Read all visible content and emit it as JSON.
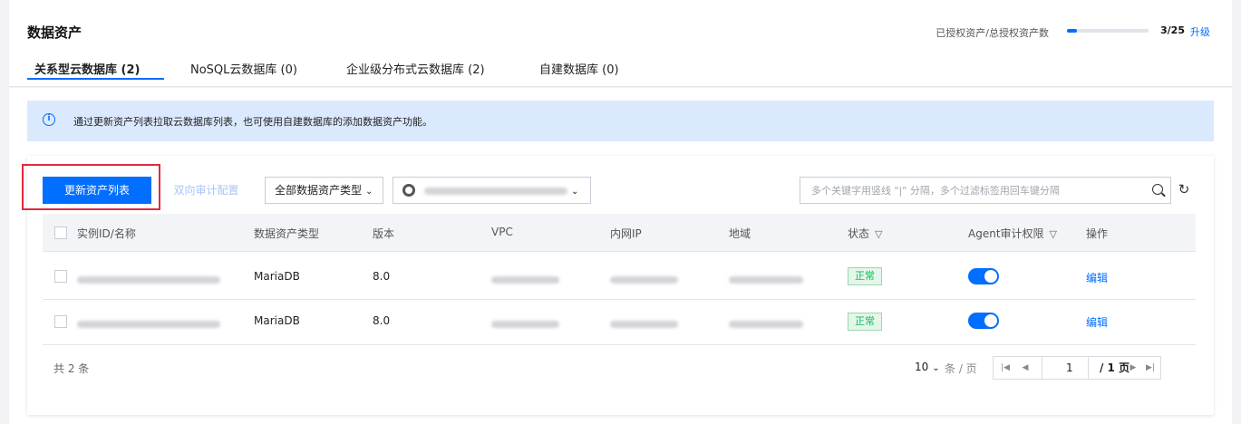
{
  "page": {
    "title": "数据资产"
  },
  "quota": {
    "label": "已授权资产/总授权资产数",
    "used": 3,
    "total": 25,
    "count_text": "3/25",
    "upgrade_label": "升级"
  },
  "tabs": [
    {
      "label": "关系型云数据库 (2)",
      "active": true
    },
    {
      "label": "NoSQL云数据库 (0)",
      "active": false
    },
    {
      "label": "企业级分布式云数据库 (2)",
      "active": false
    },
    {
      "label": "自建数据库 (0)",
      "active": false
    }
  ],
  "notice": {
    "icon": "info-icon",
    "text": "通过更新资产列表拉取云数据库列表，也可使用自建数据库的添加数据资产功能。"
  },
  "toolbar": {
    "refresh_list_label": "更新资产列表",
    "dual_audit_label": "双向审计配置",
    "asset_type_select": "全部数据资产类型",
    "search_placeholder": "多个关键字用竖线 \"|\" 分隔，多个过滤标签用回车键分隔"
  },
  "table": {
    "headers": [
      "实例ID/名称",
      "数据资产类型",
      "版本",
      "VPC",
      "内网IP",
      "地域",
      "状态",
      "Agent审计权限",
      "操作"
    ],
    "rows": [
      {
        "type": "MariaDB",
        "version": "8.0",
        "status": "正常",
        "agent_audit": true,
        "action": "编辑"
      },
      {
        "type": "MariaDB",
        "version": "8.0",
        "status": "正常",
        "agent_audit": true,
        "action": "编辑"
      }
    ]
  },
  "footer": {
    "total_text": "共 2 条",
    "page_size": "10",
    "per_page_suffix": "条 / 页",
    "current_page": "1",
    "total_pages_text": "/ 1 页"
  },
  "colors": {
    "accent": "#006eff",
    "status_ok": "#0abf5b",
    "highlight": "#e0293d"
  }
}
